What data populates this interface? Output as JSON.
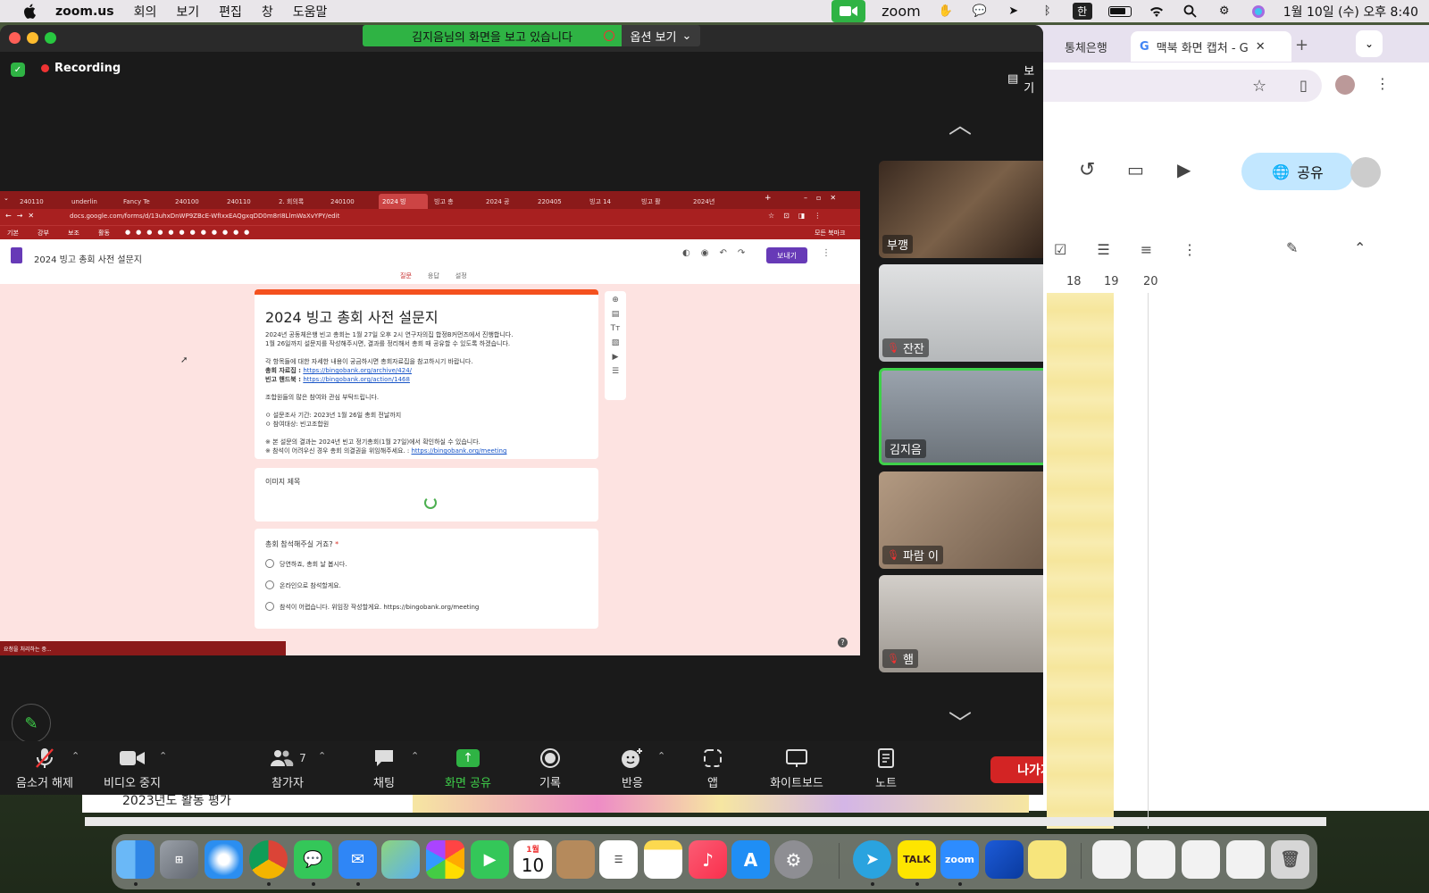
{
  "menubar": {
    "app": "zoom.us",
    "items": [
      "회의",
      "보기",
      "편집",
      "창",
      "도움말"
    ],
    "zoom_label": "zoom",
    "input_method": "한",
    "clock": "1월 10일 (수) 오후 8:40"
  },
  "chrome_bg": {
    "tab1": "통체은행",
    "tab2": "맥북 화면 캡처 - G",
    "share_label": "공유",
    "ruler": [
      "18",
      "19",
      "20"
    ]
  },
  "behind_doc_text": "2023년도 활동 평가",
  "zoom": {
    "banner_text": "김지음님의 화면을 보고 있습니다",
    "options_label": "옵션 보기",
    "recording_label": "Recording",
    "view_label": "보기",
    "participants": [
      {
        "name": "부깽",
        "muted": false,
        "active": false,
        "bg": "#5a4636"
      },
      {
        "name": "잔잔",
        "muted": true,
        "active": false,
        "bg": "#c8cacc"
      },
      {
        "name": "김지음",
        "muted": false,
        "active": true,
        "bg": "#8c95a0"
      },
      {
        "name": "파람 이",
        "muted": true,
        "active": false,
        "bg": "#9a8572"
      },
      {
        "name": "햄",
        "muted": true,
        "active": false,
        "bg": "#b9b3ab"
      }
    ],
    "toolbar": {
      "unmute": "음소거 해제",
      "stop_video": "비디오 중지",
      "participants": "참가자",
      "participant_count": "7",
      "chat": "채팅",
      "share": "화면 공유",
      "record": "기록",
      "reactions": "반응",
      "apps": "앱",
      "whiteboard": "화이트보드",
      "notes": "노트",
      "leave": "나가기"
    }
  },
  "shared_screen": {
    "tabs": [
      "240110",
      "underlin",
      "Fancy Te",
      "240100",
      "240110",
      "2. 회의록",
      "240100",
      "2024 빙",
      "빙고 총",
      "2024 공",
      "220405",
      "빙고 14",
      "빙고 활",
      "2024년"
    ],
    "url": "docs.google.com/forms/d/13uhxDnWP9ZBcE-WfIxxEAQgxqDD0m8rI8LlmWaXvYPY/edit",
    "bookmarks": [
      "기본",
      "강부",
      "보조",
      "활동"
    ],
    "bookmark_right": "모든 북마크",
    "form_title": "2024 빙고 총회 사전 설문지",
    "send": "보내기",
    "form_tabs": [
      "질문",
      "응답",
      "설정"
    ],
    "card_title": "2024 빙고 총회 사전 설문지",
    "desc_lines": [
      "2024년 공동체은행 빈고 총회는 1월 27일 오후 2시 연구자의집 합정B커먼즈에서 진행합니다.",
      "1월 26일까지 설문지를 작성해주시면, 결과를 정리해서 총회 때 공유할 수 있도록 하겠습니다.",
      "각 항목들에 대한 자세한 내용이 궁금하시면 총회자료집을 참고하시기 바랍니다.",
      "조합원들의 많은 참여와 관심 부탁드립니다.",
      "ㅇ 설문조사 기간:  2023년 1월 26일 총회 전날까지",
      "ㅇ 참여대상: 빈고조합원",
      "※ 본 설문의 결과는 2024년 빈고 정기총회(1월 27일)에서 확인하실 수 있습니다.",
      "※ 참석이 어려우신 경우 총회 의결권을 위임해주세요. : "
    ],
    "link1_label": "총회 자료집 : ",
    "link1": "https://bingobank.org/archive/424/",
    "link2_label": "빈고 핸드북 : ",
    "link2": "https://bingobank.org/action/1468",
    "link3": "https://bingobank.org/meeting",
    "image_title": "이미지 제목",
    "question": "총회 참석해주실 거죠?",
    "required_mark": "*",
    "options": [
      "당연하죠, 총회 날 봅시다.",
      "온라인으로 참석할게요.",
      "참석이 어렵습니다. 위임장 작성할게요. https://bingobank.org/meeting"
    ],
    "status": "요청을 처리하는 중..."
  },
  "dock": {
    "calendar_month": "1월",
    "calendar_day": "10",
    "talk": "TALK",
    "zoom": "zoom"
  }
}
